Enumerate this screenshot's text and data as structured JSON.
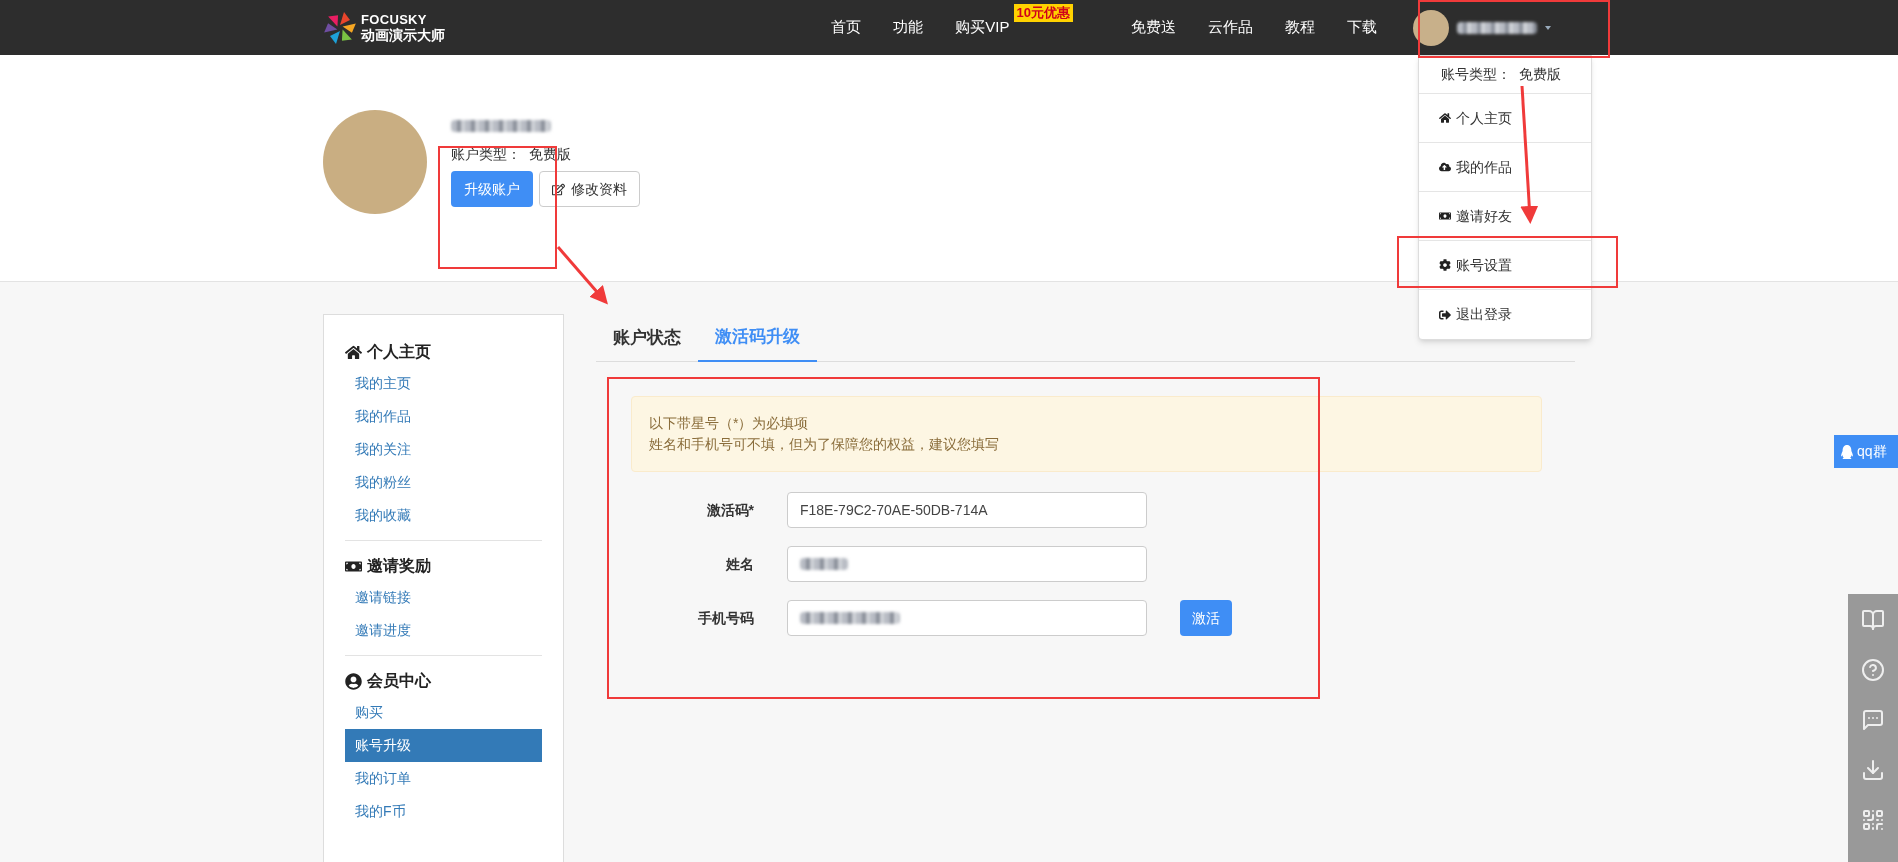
{
  "header": {
    "logo": {
      "brand": "FOCUSKY",
      "tagline": "动画演示大师"
    },
    "nav": [
      {
        "label": "首页"
      },
      {
        "label": "功能"
      },
      {
        "label": "购买VIP",
        "badge": "10元优惠"
      },
      {
        "label": "免费送"
      },
      {
        "label": "云作品"
      },
      {
        "label": "教程"
      },
      {
        "label": "下载"
      }
    ]
  },
  "user_menu": {
    "account_type_label": "账号类型：",
    "account_type": "免费版",
    "items": [
      {
        "label": "个人主页"
      },
      {
        "label": "我的作品"
      },
      {
        "label": "邀请好友"
      },
      {
        "label": "账号设置"
      },
      {
        "label": "退出登录"
      }
    ]
  },
  "profile": {
    "account_type_label": "账户类型：",
    "account_type": "免费版",
    "buttons": [
      {
        "label": "升级账户",
        "kind": "primary"
      },
      {
        "label": "修改资料",
        "kind": "edit"
      }
    ]
  },
  "sidebar": {
    "sections": [
      {
        "title": "个人主页",
        "items": [
          {
            "label": "我的主页",
            "selected": false
          },
          {
            "label": "我的作品",
            "selected": false
          },
          {
            "label": "我的关注",
            "selected": false
          },
          {
            "label": "我的粉丝",
            "selected": false
          },
          {
            "label": "我的收藏",
            "selected": false
          }
        ]
      },
      {
        "title": "邀请奖励",
        "items": [
          {
            "label": "邀请链接",
            "selected": false
          },
          {
            "label": "邀请进度",
            "selected": false
          }
        ]
      },
      {
        "title": "会员中心",
        "items": [
          {
            "label": "购买",
            "selected": false
          },
          {
            "label": "账号升级",
            "selected": true
          },
          {
            "label": "我的订单",
            "selected": false
          },
          {
            "label": "我的F币",
            "selected": false
          }
        ]
      }
    ]
  },
  "tabs": [
    {
      "label": "账户状态",
      "selected": false
    },
    {
      "label": "激活码升级",
      "selected": true
    }
  ],
  "notice": [
    "以下带星号（*）为必填项",
    "姓名和手机号可不填，但为了保障您的权益，建议您填写"
  ],
  "form": {
    "fields": [
      {
        "label": "激活码*",
        "value": "F18E-79C2-70AE-50DB-714A"
      },
      {
        "label": "姓名"
      },
      {
        "label": "手机号码"
      }
    ],
    "submit": "激活"
  },
  "float": {
    "qq": "qq群"
  }
}
